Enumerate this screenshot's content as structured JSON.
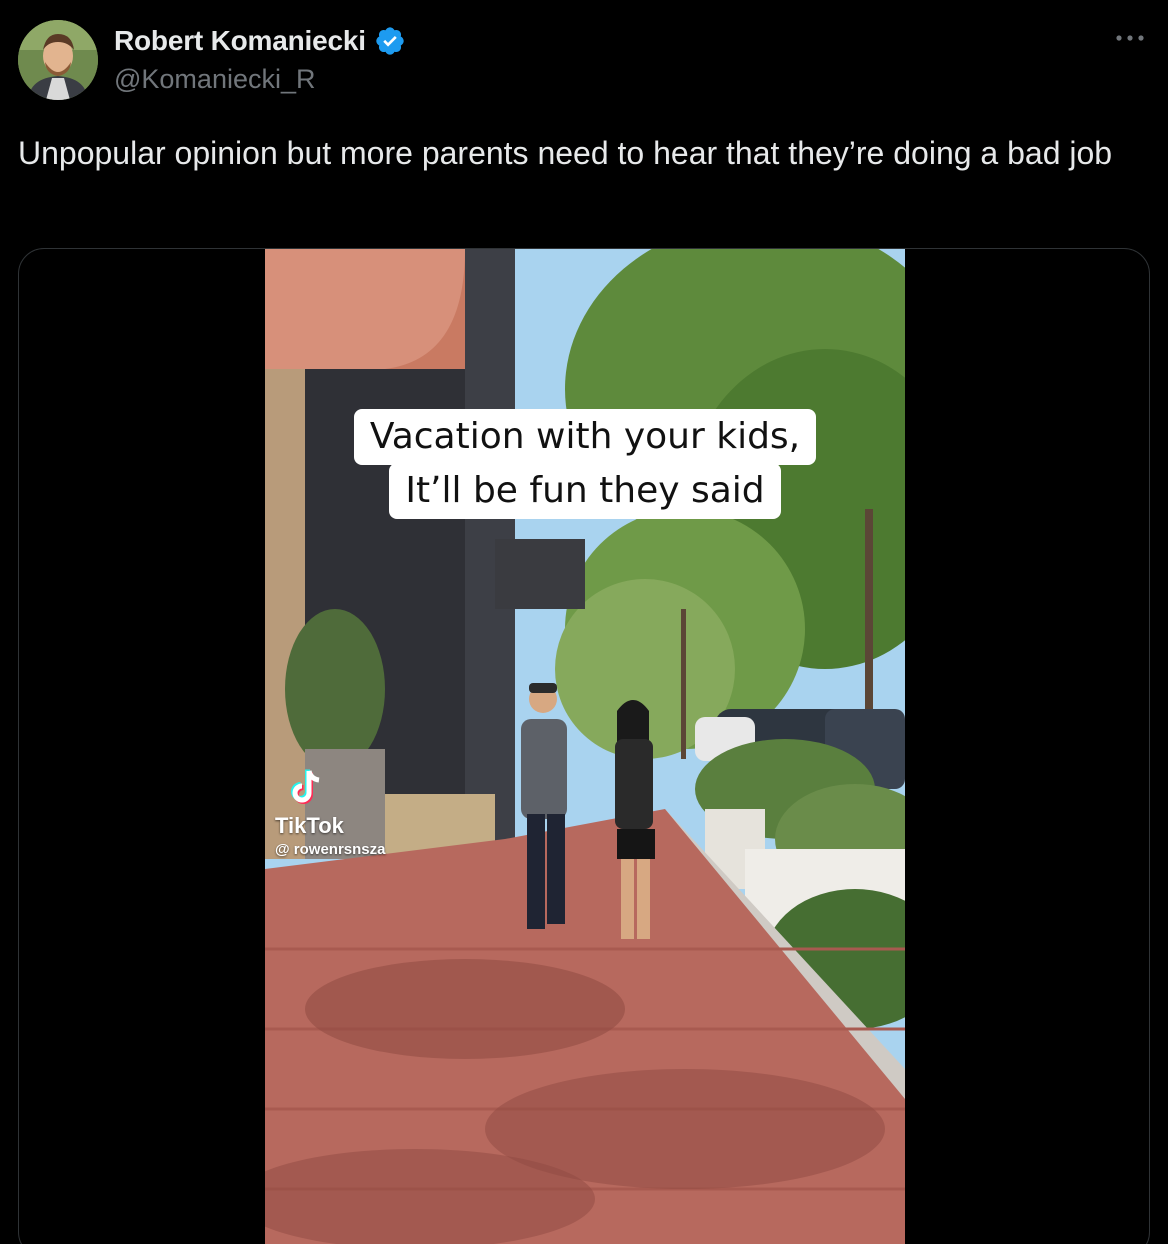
{
  "author": {
    "display_name": "Robert Komaniecki",
    "handle": "@Komaniecki_R",
    "verified": true,
    "verified_color": "#1d9bf0"
  },
  "more_icon": "more-horizontal-icon",
  "tweet": {
    "text": "Unpopular opinion but more parents need to hear that they’re doing a bad job"
  },
  "media": {
    "type": "video",
    "caption_line_1": "Vacation with your kids,",
    "caption_line_2": "It’ll be fun they said",
    "watermark_brand": "TikTok",
    "watermark_user": "@ rowenrsnsza"
  },
  "colors": {
    "background": "#000000",
    "text_primary": "#e7e9ea",
    "text_secondary": "#71767b",
    "border": "#2f3336"
  }
}
